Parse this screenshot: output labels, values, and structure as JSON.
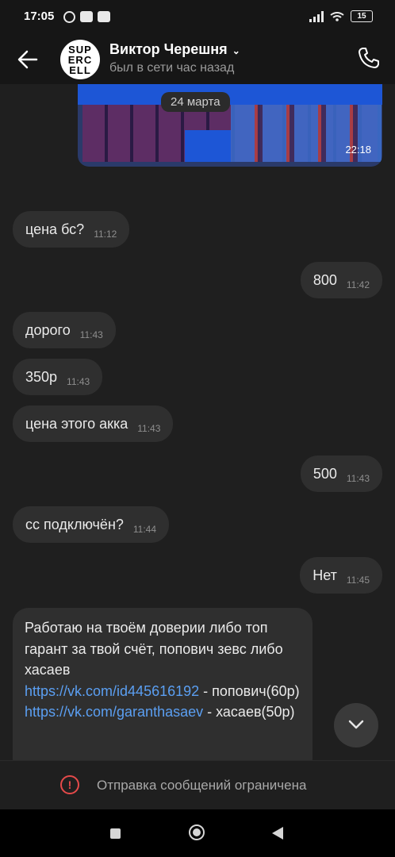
{
  "status": {
    "time": "17:05",
    "battery": "15"
  },
  "header": {
    "name": "Виктор Черешня",
    "presence": "был в сети час назад",
    "avatar_text": [
      "SUP",
      "ERC",
      "ELL"
    ]
  },
  "photo": {
    "date_chip": "24 марта",
    "time": "22:18"
  },
  "messages": [
    {
      "dir": "in",
      "text": "цена бс?",
      "time": "11:12"
    },
    {
      "dir": "out",
      "text": "800",
      "time": "11:42"
    },
    {
      "dir": "in",
      "text": "дорого",
      "time": "11:43"
    },
    {
      "dir": "in",
      "text": "350р",
      "time": "11:43"
    },
    {
      "dir": "in",
      "text": "цена этого акка",
      "time": "11:43"
    },
    {
      "dir": "out",
      "text": "500",
      "time": "11:43"
    },
    {
      "dir": "in",
      "text": "сс подключён?",
      "time": "11:44"
    },
    {
      "dir": "out",
      "text": "Нет",
      "time": "11:45"
    }
  ],
  "long_message": {
    "line1": "Работаю на твоём доверии либо топ гарант за твой счёт, попович зевс либо хасаев",
    "link1": "https://vk.com/id445616192",
    "after1": " - попович(60р)",
    "link2": "https://vk.com/garanthasaev",
    "after2": " - хасаев(50р)"
  },
  "restriction": {
    "text": "Отправка сообщений ограничена"
  },
  "colors": {
    "accent_link": "#5b9ff2",
    "warning": "#e54a4a",
    "bubble": "#2f2f2f"
  }
}
